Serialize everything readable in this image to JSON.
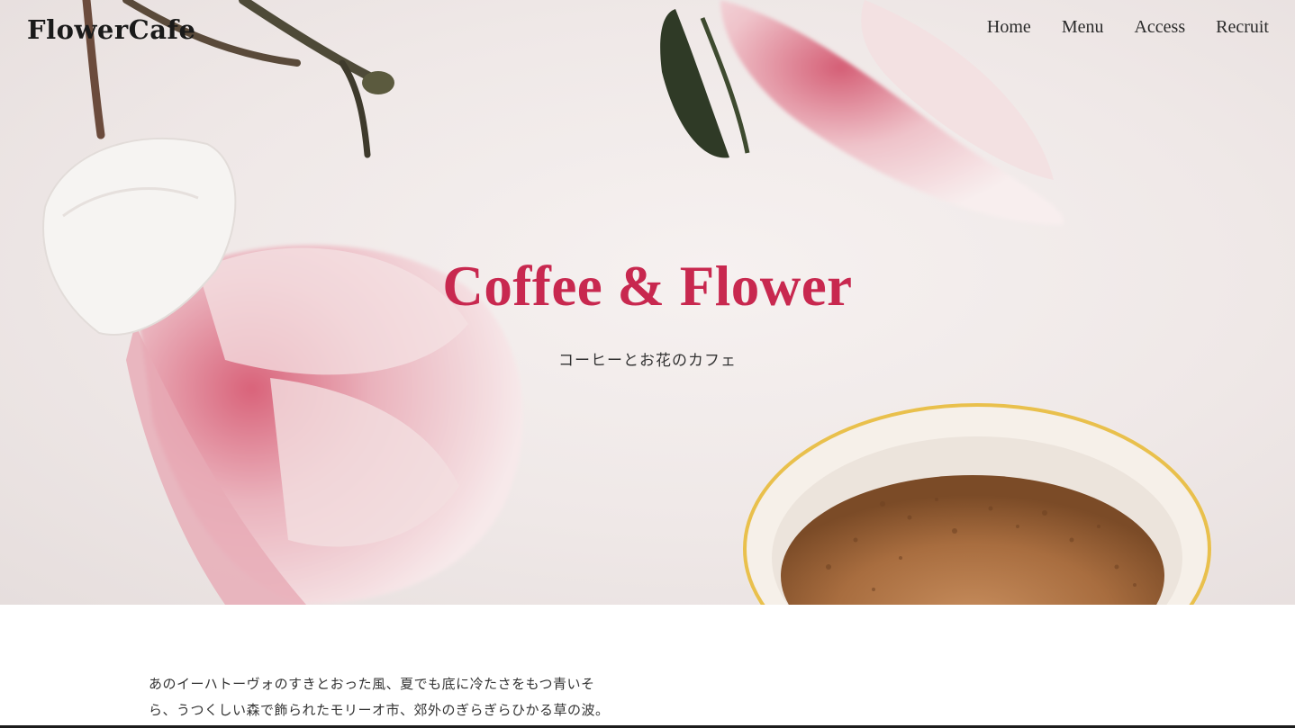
{
  "header": {
    "logo": "FlowerCafe",
    "nav": [
      "Home",
      "Menu",
      "Access",
      "Recruit"
    ]
  },
  "hero": {
    "title": "Coffee & Flower",
    "subtitle": "コーヒーとお花のカフェ"
  },
  "intro": {
    "lines": [
      "あのイーハトーヴォのすきとおった風、夏でも底に冷たさをもつ青いそ",
      "ら、うつくしい森で飾られたモリーオ市、郊外のぎらぎらひかる草の波。"
    ]
  },
  "colors": {
    "accent": "#c8284f",
    "text": "#222222",
    "hero_bg": "#efe8e7"
  }
}
